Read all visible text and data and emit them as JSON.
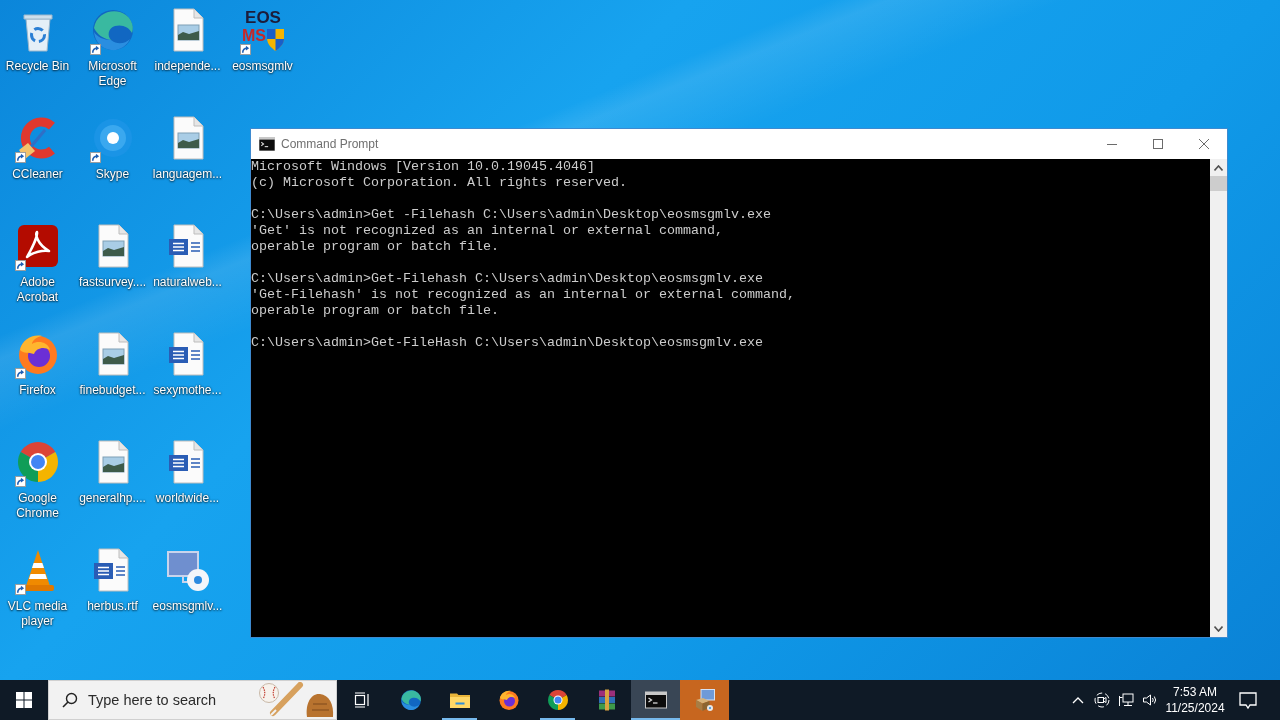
{
  "desktop": {
    "icons": [
      {
        "label": "Recycle Bin",
        "kind": "recycle-bin",
        "shortcut": false
      },
      {
        "label": "CCleaner",
        "kind": "ccleaner",
        "shortcut": true
      },
      {
        "label": "Adobe Acrobat",
        "kind": "acrobat",
        "shortcut": true
      },
      {
        "label": "Firefox",
        "kind": "firefox",
        "shortcut": true
      },
      {
        "label": "Google Chrome",
        "kind": "chrome",
        "shortcut": true
      },
      {
        "label": "VLC media player",
        "kind": "vlc",
        "shortcut": true
      },
      {
        "label": "Microsoft Edge",
        "kind": "edge",
        "shortcut": true
      },
      {
        "label": "Skype",
        "kind": "skype",
        "shortcut": true
      },
      {
        "label": "fastsurvey....",
        "kind": "image-file",
        "shortcut": false
      },
      {
        "label": "finebudget...",
        "kind": "image-file",
        "shortcut": false
      },
      {
        "label": "generalhp....",
        "kind": "image-file",
        "shortcut": false
      },
      {
        "label": "herbus.rtf",
        "kind": "word-file",
        "shortcut": false
      },
      {
        "label": "independe...",
        "kind": "image-file",
        "shortcut": false
      },
      {
        "label": "languagem...",
        "kind": "image-file",
        "shortcut": false
      },
      {
        "label": "naturalweb...",
        "kind": "word-file",
        "shortcut": false
      },
      {
        "label": "sexymothe...",
        "kind": "word-file",
        "shortcut": false
      },
      {
        "label": "worldwide...",
        "kind": "word-file",
        "shortcut": false
      },
      {
        "label": "eosmsgmlv...",
        "kind": "setup",
        "shortcut": false
      },
      {
        "label": "eosmsgmlv",
        "kind": "logo",
        "logo_text": [
          "EOS",
          "MS"
        ],
        "shortcut": true
      }
    ]
  },
  "window": {
    "title": "Command Prompt",
    "console": {
      "blocks": [
        [
          "Microsoft Windows [Version 10.0.19045.4046]",
          "(c) Microsoft Corporation. All rights reserved."
        ],
        [
          "C:\\Users\\admin>Get -Filehash C:\\Users\\admin\\Desktop\\eosmsgmlv.exe",
          "'Get' is not recognized as an internal or external command,",
          "operable program or batch file."
        ],
        [
          "C:\\Users\\admin>Get-Filehash C:\\Users\\admin\\Desktop\\eosmsgmlv.exe",
          "'Get-Filehash' is not recognized as an internal or external command,",
          "operable program or batch file."
        ],
        [
          "C:\\Users\\admin>Get-FileHash C:\\Users\\admin\\Desktop\\eosmsgmlv.exe"
        ]
      ]
    }
  },
  "taskbar": {
    "search": {
      "placeholder": "Type here to search"
    },
    "apps": [
      {
        "kind": "edge",
        "running": false,
        "active": false,
        "attention": false
      },
      {
        "kind": "explorer",
        "running": true,
        "active": false,
        "attention": false
      },
      {
        "kind": "firefox",
        "running": false,
        "active": false,
        "attention": false
      },
      {
        "kind": "chrome",
        "running": true,
        "active": false,
        "attention": false
      },
      {
        "kind": "winrar",
        "running": false,
        "active": false,
        "attention": false
      },
      {
        "kind": "cmd",
        "running": true,
        "active": true,
        "attention": false
      },
      {
        "kind": "installer",
        "running": false,
        "active": false,
        "attention": true
      }
    ],
    "clock": {
      "time": "7:53 AM",
      "date": "11/25/2024"
    }
  }
}
